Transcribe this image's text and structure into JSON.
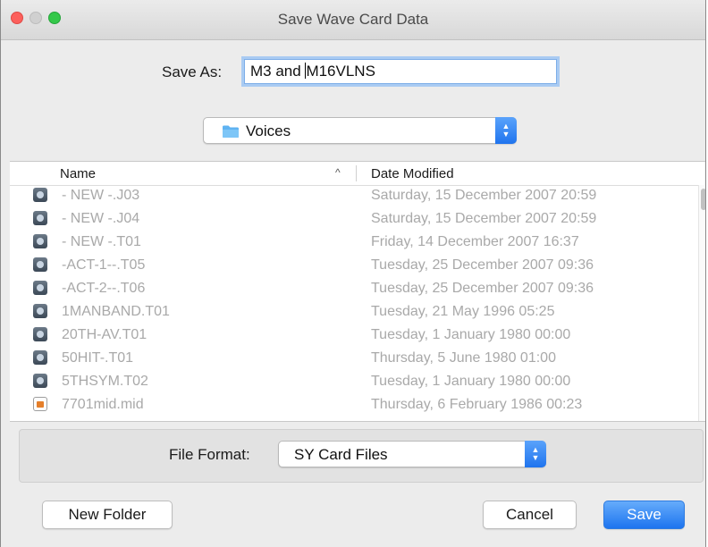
{
  "window": {
    "title": "Save Wave Card Data"
  },
  "colors": {
    "accent": "#2677f0",
    "close": "#fc605c",
    "minimize_inactive": "#d0d0d0",
    "zoom": "#34c84a"
  },
  "save_as": {
    "label": "Save As:",
    "value_before_caret": "M3 and ",
    "value_after_caret": "M16VLNS"
  },
  "location": {
    "folder": "Voices",
    "folder_icon": "folder-icon"
  },
  "columns": {
    "name": "Name",
    "sort_indicator": "^",
    "date": "Date Modified"
  },
  "files": [
    {
      "name": "- NEW -.J03",
      "date": "Saturday, 15 December 2007 20:59",
      "icon": "voice-file-icon"
    },
    {
      "name": "- NEW -.J04",
      "date": "Saturday, 15 December 2007 20:59",
      "icon": "voice-file-icon"
    },
    {
      "name": "- NEW -.T01",
      "date": "Friday, 14 December 2007 16:37",
      "icon": "voice-file-icon"
    },
    {
      "name": "-ACT-1--.T05",
      "date": "Tuesday, 25 December 2007 09:36",
      "icon": "voice-file-icon"
    },
    {
      "name": "-ACT-2--.T06",
      "date": "Tuesday, 25 December 2007 09:36",
      "icon": "voice-file-icon"
    },
    {
      "name": "1MANBAND.T01",
      "date": "Tuesday, 21 May 1996 05:25",
      "icon": "voice-file-icon"
    },
    {
      "name": "20TH-AV.T01",
      "date": "Tuesday, 1 January 1980 00:00",
      "icon": "voice-file-icon"
    },
    {
      "name": "50HIT-.T01",
      "date": "Thursday, 5 June 1980 01:00",
      "icon": "voice-file-icon"
    },
    {
      "name": "5THSYM.T02",
      "date": "Tuesday, 1 January 1980 00:00",
      "icon": "voice-file-icon"
    },
    {
      "name": "7701mid.mid",
      "date": "Thursday, 6 February 1986 00:23",
      "icon": "midi-file-icon"
    }
  ],
  "file_format": {
    "label": "File Format:",
    "value": "SY Card Files"
  },
  "buttons": {
    "new_folder": "New Folder",
    "cancel": "Cancel",
    "save": "Save"
  }
}
